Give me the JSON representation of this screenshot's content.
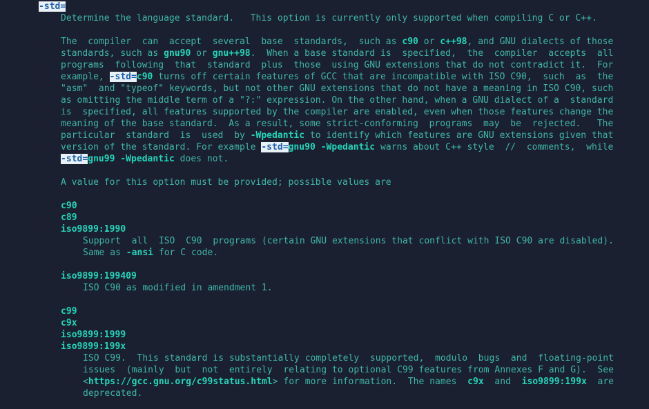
{
  "option_name": "-std=",
  "summary": "Determine the language standard.   This option is currently only supported when compiling C or C++.",
  "p1": {
    "l1_1": "The  compiler  can  accept  several  base  standards,  such as ",
    "l1_c90": "c90",
    "l1_or": " or ",
    "l1_cpp98": "c++98",
    "l1_2": ", and GNU dialects of those",
    "l2_1": "standards, such as ",
    "l2_gnu90": "gnu90",
    "l2_or": " or ",
    "l2_gnupp98": "gnu++98",
    "l2_2": ".  When a base standard is  specified,  the  compiler  accepts  all",
    "l3": "programs  following  that  standard  plus  those  using GNU extensions that do not contradict it.  For",
    "l4_1": "example, ",
    "l4_opt": "-std=",
    "l4_c90": "c90",
    "l4_2": " turns off certain features of GCC that are incompatible with ISO C90,  such  as  the",
    "l5": "\"asm\"  and \"typeof\" keywords, but not other GNU extensions that do not have a meaning in ISO C90, such",
    "l6": "as omitting the middle term of a \"?:\" expression. On the other hand, when a GNU dialect of a  standard",
    "l7": "is  specified, all features supported by the compiler are enabled, even when those features change the",
    "l8": "meaning of the base standard.  As a result, some strict-conforming  programs  may  be  rejected.   The",
    "l9_1": "particular  standard  is  used  by ",
    "l9_wp": "-Wpedantic",
    "l9_2": " to identify which features are GNU extensions given that",
    "l10_1": "version of the standard. For example ",
    "l10_opt": "-std=",
    "l10_gnu90": "gnu90",
    "l10_sp": " ",
    "l10_wp": "-Wpedantic",
    "l10_2": " warns about C++ style  //  comments,  while",
    "l11_opt": "-std=",
    "l11_gnu99": "gnu99",
    "l11_sp": " ",
    "l11_wp": "-Wpedantic",
    "l11_2": " does not."
  },
  "values_intro": "A value for this option must be provided; possible values are",
  "group_c90": {
    "names": [
      "c90",
      "c89",
      "iso9899:1990"
    ],
    "desc1": "Support  all  ISO  C90  programs (certain GNU extensions that conflict with ISO C90 are disabled).",
    "desc2_1": "Same as ",
    "desc2_ansi": "-ansi",
    "desc2_2": " for C code."
  },
  "group_199409": {
    "name": "iso9899:199409",
    "desc": "ISO C90 as modified in amendment 1."
  },
  "group_c99": {
    "names": [
      "c99",
      "c9x",
      "iso9899:1999",
      "iso9899:199x"
    ],
    "d1": "ISO C99.  This standard is substantially completely  supported,  modulo  bugs  and  floating-point",
    "d2": "issues  (mainly  but  not  entirely  relating to optional C99 features from Annexes F and G).  See",
    "d3_lt": "<",
    "d3_url": "https://gcc.gnu.org/c99status.html",
    "d3_1": "> for more information.  The names  ",
    "d3_c9x": "c9x",
    "d3_and": "  and  ",
    "d3_iso": "iso9899:199x",
    "d3_2": "  are",
    "d4": "deprecated."
  },
  "colors": {
    "background": "#1b2030",
    "text": "#3fb6a8",
    "bold": "#1fd6b9",
    "search_highlight_bg": "#e8f0f8",
    "search_highlight_fg": "#1e5fb0"
  }
}
